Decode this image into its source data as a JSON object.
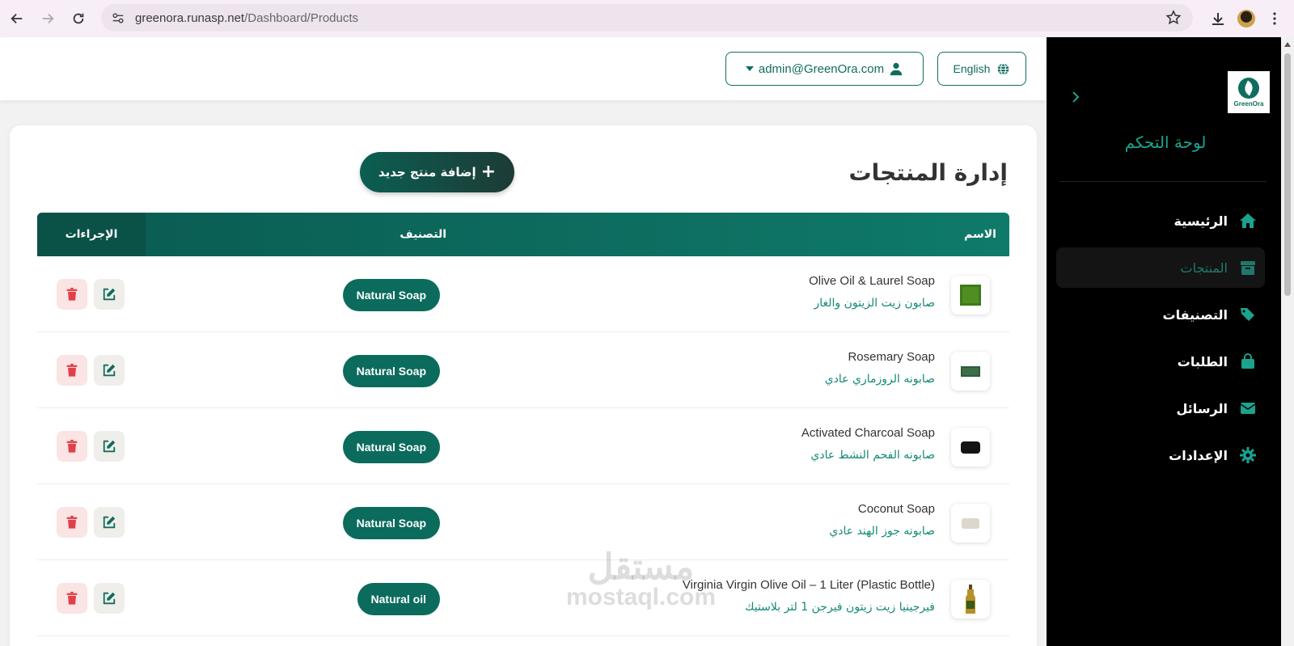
{
  "browser": {
    "url_host": "greenora.runasp.net",
    "url_path": "/Dashboard/Products"
  },
  "sidebar": {
    "logo_text": "GreenOra",
    "title": "لوحة التحكم",
    "items": [
      {
        "label": "الرئيسية",
        "icon": "home-icon",
        "active": false
      },
      {
        "label": "المنتجات",
        "icon": "box-icon",
        "active": true
      },
      {
        "label": "التصنيفات",
        "icon": "tags-icon",
        "active": false
      },
      {
        "label": "الطلبات",
        "icon": "shopping-bag-icon",
        "active": false
      },
      {
        "label": "الرسائل",
        "icon": "envelope-icon",
        "active": false
      },
      {
        "label": "الإعدادات",
        "icon": "gear-icon",
        "active": false
      }
    ]
  },
  "topbar": {
    "language_label": "English",
    "user_email": "admin@GreenOra.com"
  },
  "main": {
    "title": "إدارة المنتجات",
    "add_button_label": "إضافة منتج جديد",
    "columns": {
      "name": "الاسم",
      "category": "التصنيف",
      "actions": "الإجراءات"
    },
    "products": [
      {
        "name_en": "Olive Oil & Laurel Soap",
        "name_ar": "صابون زيت الزيتون والغار",
        "category": "Natural Soap",
        "thumb": "green-soap"
      },
      {
        "name_en": "Rosemary Soap",
        "name_ar": "صابونه الروزماري عادي",
        "category": "Natural Soap",
        "thumb": "rosemary-soap"
      },
      {
        "name_en": "Activated Charcoal Soap",
        "name_ar": "صابونه الفحم النشط عادي",
        "category": "Natural Soap",
        "thumb": "charcoal-soap"
      },
      {
        "name_en": "Coconut Soap",
        "name_ar": "صابونه جوز الهند عادي",
        "category": "Natural Soap",
        "thumb": "coconut-soap"
      },
      {
        "name_en": "Virginia Virgin Olive Oil – 1 Liter (Plastic Bottle)",
        "name_ar": "فيرجينيا زيت زيتون فيرجن 1 لتر بلاستيك",
        "category": "Natural oil",
        "thumb": "olive-oil-bottle"
      }
    ]
  },
  "watermark": {
    "ar": "مستقل",
    "en": "mostaql.com"
  },
  "colors": {
    "brand": "#0f6d5f",
    "sidebar_bg": "#000000",
    "delete": "#e0404a"
  }
}
